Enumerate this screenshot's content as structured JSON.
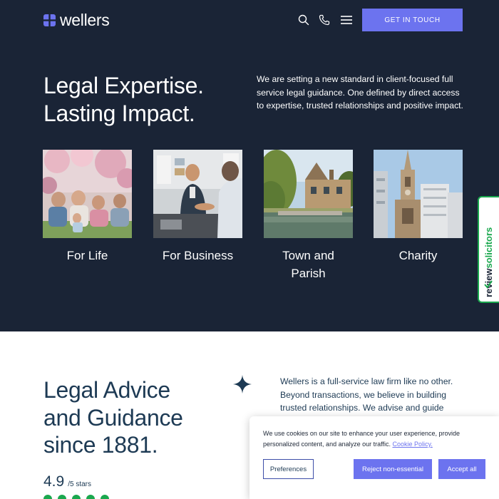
{
  "header": {
    "logo_text": "wellers",
    "cta_label": "GET IN TOUCH",
    "icons": [
      "search-icon",
      "phone-icon",
      "menu-icon"
    ]
  },
  "hero": {
    "title_line1": "Legal Expertise.",
    "title_line2": "Lasting Impact.",
    "description": "We are setting a new standard in client-focused full service legal guidance. One defined by direct access to expertise, trusted relationships and positive impact."
  },
  "cards": [
    {
      "label": "For Life"
    },
    {
      "label": "For Business"
    },
    {
      "label": "Town and Parish"
    },
    {
      "label": "Charity"
    }
  ],
  "review_badge": {
    "text_a": "review",
    "text_b": "solicitors"
  },
  "intro": {
    "title_line1": "Legal Advice",
    "title_line2": "and Guidance",
    "title_line3": "since 1881.",
    "rating_value": "4.9",
    "rating_suffix": "/5 stars",
    "text": "Wellers is a full-service law firm like no other. Beyond transactions, we believe in building trusted relationships. We advise and guide"
  },
  "cookie": {
    "message": "We use cookies on our site to enhance your user experience, provide personalized content, and analyze our traffic.",
    "link_text": "Cookie Policy.",
    "preferences_label": "Preferences",
    "reject_label": "Reject non-essential",
    "accept_label": "Accept all"
  },
  "colors": {
    "navy": "#1a2436",
    "accent": "#6c73ef",
    "text_dark": "#1d3a54",
    "review_green": "#1aa84e"
  }
}
